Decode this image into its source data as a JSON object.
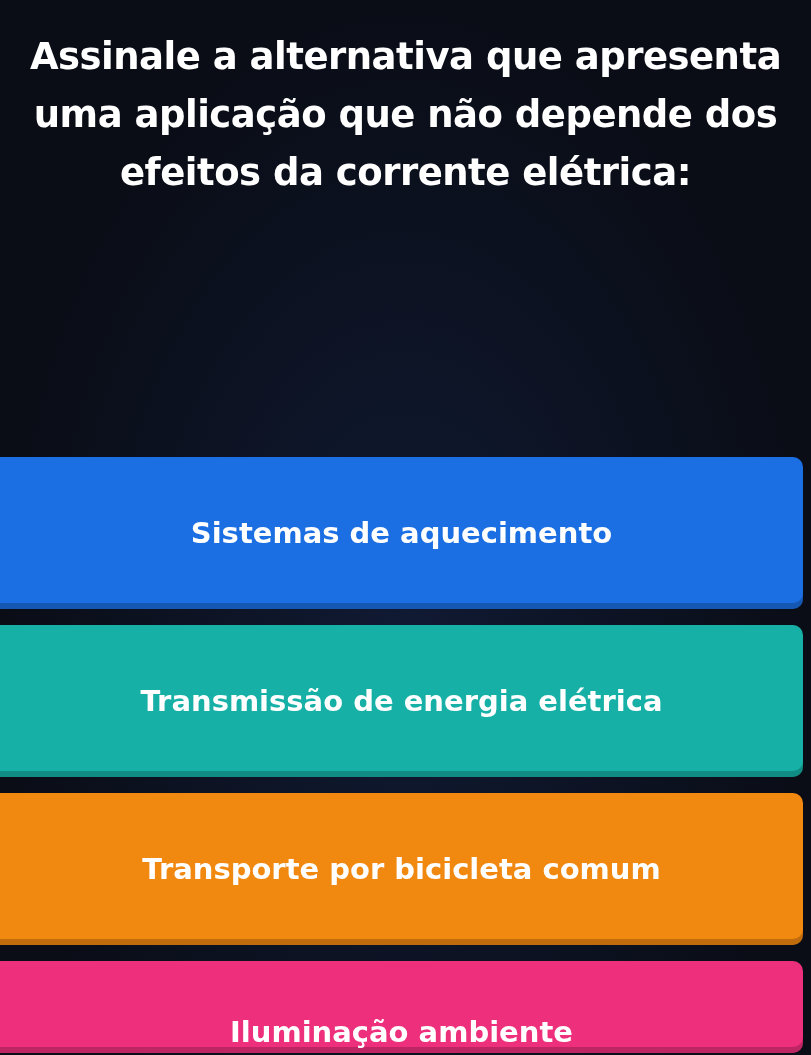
{
  "question": "Assinale a alternativa que apresenta uma aplicação que não depende dos efeitos da corrente elétrica:",
  "options": [
    {
      "text": "Sistemas de aquecimento",
      "color": "#1b6fe2"
    },
    {
      "text": "Transmissão de energia elétrica",
      "color": "#16b0a6"
    },
    {
      "text": "Transporte por bicicleta comum",
      "color": "#f1880f"
    },
    {
      "text": "Iluminação ambiente",
      "color": "#ee2f7c"
    }
  ]
}
